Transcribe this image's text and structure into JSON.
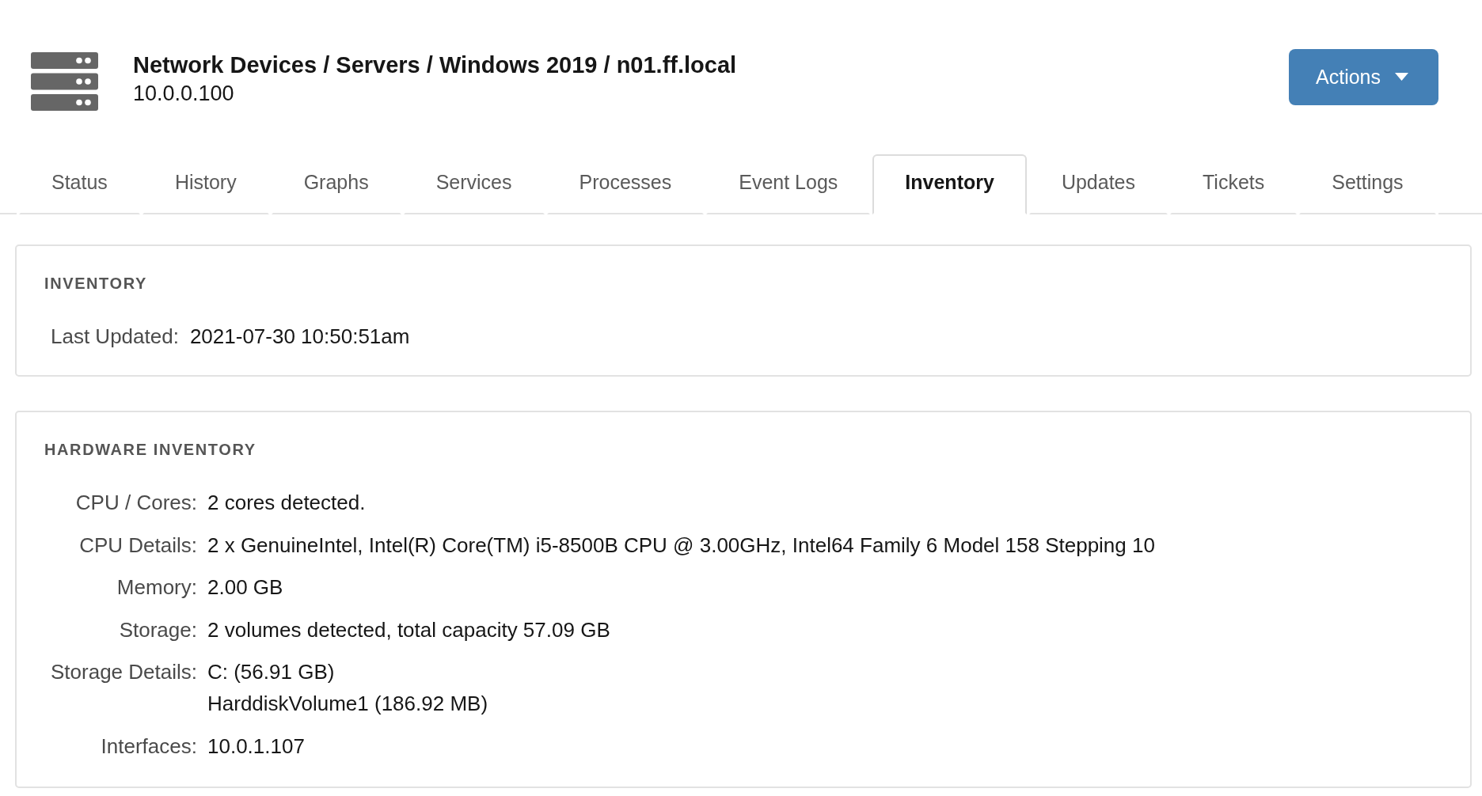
{
  "header": {
    "title": "Network Devices / Servers / Windows 2019 / n01.ff.local",
    "subtitle": "10.0.0.100",
    "actions_button": {
      "label": "Actions"
    }
  },
  "tabs": [
    {
      "label": "Status",
      "selected": false
    },
    {
      "label": "History",
      "selected": false
    },
    {
      "label": "Graphs",
      "selected": false
    },
    {
      "label": "Services",
      "selected": false
    },
    {
      "label": "Processes",
      "selected": false
    },
    {
      "label": "Event Logs",
      "selected": false
    },
    {
      "label": "Inventory",
      "selected": true
    },
    {
      "label": "Updates",
      "selected": false
    },
    {
      "label": "Tickets",
      "selected": false
    },
    {
      "label": "Settings",
      "selected": false
    }
  ],
  "inventory_panel": {
    "title": "INVENTORY",
    "fields": [
      {
        "label": "Last Updated:",
        "value": "2021-07-30 10:50:51am"
      }
    ]
  },
  "hardware_panel": {
    "title": "HARDWARE INVENTORY",
    "fields": [
      {
        "label": "CPU / Cores:",
        "values": [
          "2 cores detected."
        ]
      },
      {
        "label": "CPU Details:",
        "values": [
          "2 x GenuineIntel, Intel(R) Core(TM) i5-8500B CPU @ 3.00GHz, Intel64 Family 6 Model 158 Stepping 10"
        ]
      },
      {
        "label": "Memory:",
        "values": [
          "2.00 GB"
        ]
      },
      {
        "label": "Storage:",
        "values": [
          "2 volumes detected, total capacity 57.09 GB"
        ]
      },
      {
        "label": "Storage Details:",
        "values": [
          "C: (56.91 GB)",
          "HarddiskVolume1 (186.92 MB)"
        ]
      },
      {
        "label": "Interfaces:",
        "values": [
          "10.0.1.107"
        ]
      }
    ]
  }
}
